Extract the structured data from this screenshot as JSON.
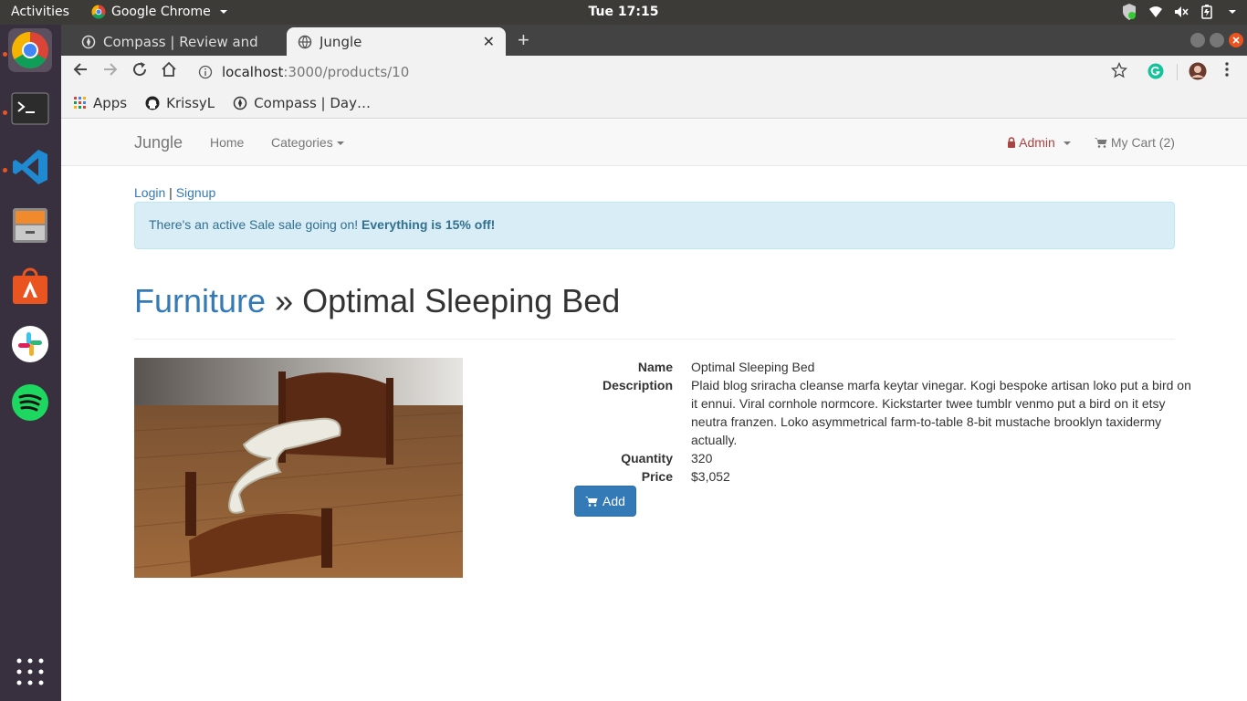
{
  "os": {
    "activities": "Activities",
    "app_name": "Google Chrome",
    "clock": "Tue 17:15"
  },
  "browser": {
    "tabs": [
      {
        "title": "Compass | Review and Sub"
      },
      {
        "title": "Jungle"
      }
    ],
    "url_host": "localhost",
    "url_path": ":3000/products/10",
    "bookmarks": [
      {
        "label": "Apps"
      },
      {
        "label": "KrissyL"
      },
      {
        "label": "Compass | Day…"
      }
    ]
  },
  "site": {
    "brand": "Jungle",
    "nav": {
      "home": "Home",
      "categories": "Categories",
      "admin": "Admin",
      "cart": "My Cart (2)"
    },
    "auth": {
      "login": "Login",
      "sep": "|",
      "signup": "Signup"
    },
    "alert": {
      "text": "There's an active Sale sale going on! ",
      "strong": "Everything is 15% off!"
    }
  },
  "product": {
    "category": "Furniture",
    "separator": " » ",
    "name": "Optimal Sleeping Bed",
    "labels": {
      "name": "Name",
      "description": "Description",
      "quantity": "Quantity",
      "price": "Price"
    },
    "description": "Plaid blog sriracha cleanse marfa keytar vinegar. Kogi bespoke artisan loko put a bird on it ennui. Viral cornhole normcore. Kickstarter twee tumblr venmo put a bird on it etsy neutra franzen. Loko asymmetrical farm-to-table 8-bit mustache brooklyn taxidermy actually.",
    "quantity": "320",
    "price": "$3,052",
    "add_label": "Add"
  },
  "colors": {
    "link": "#337ab7",
    "admin": "#a94442",
    "alert_bg": "#d9edf7",
    "button": "#337ab7"
  }
}
